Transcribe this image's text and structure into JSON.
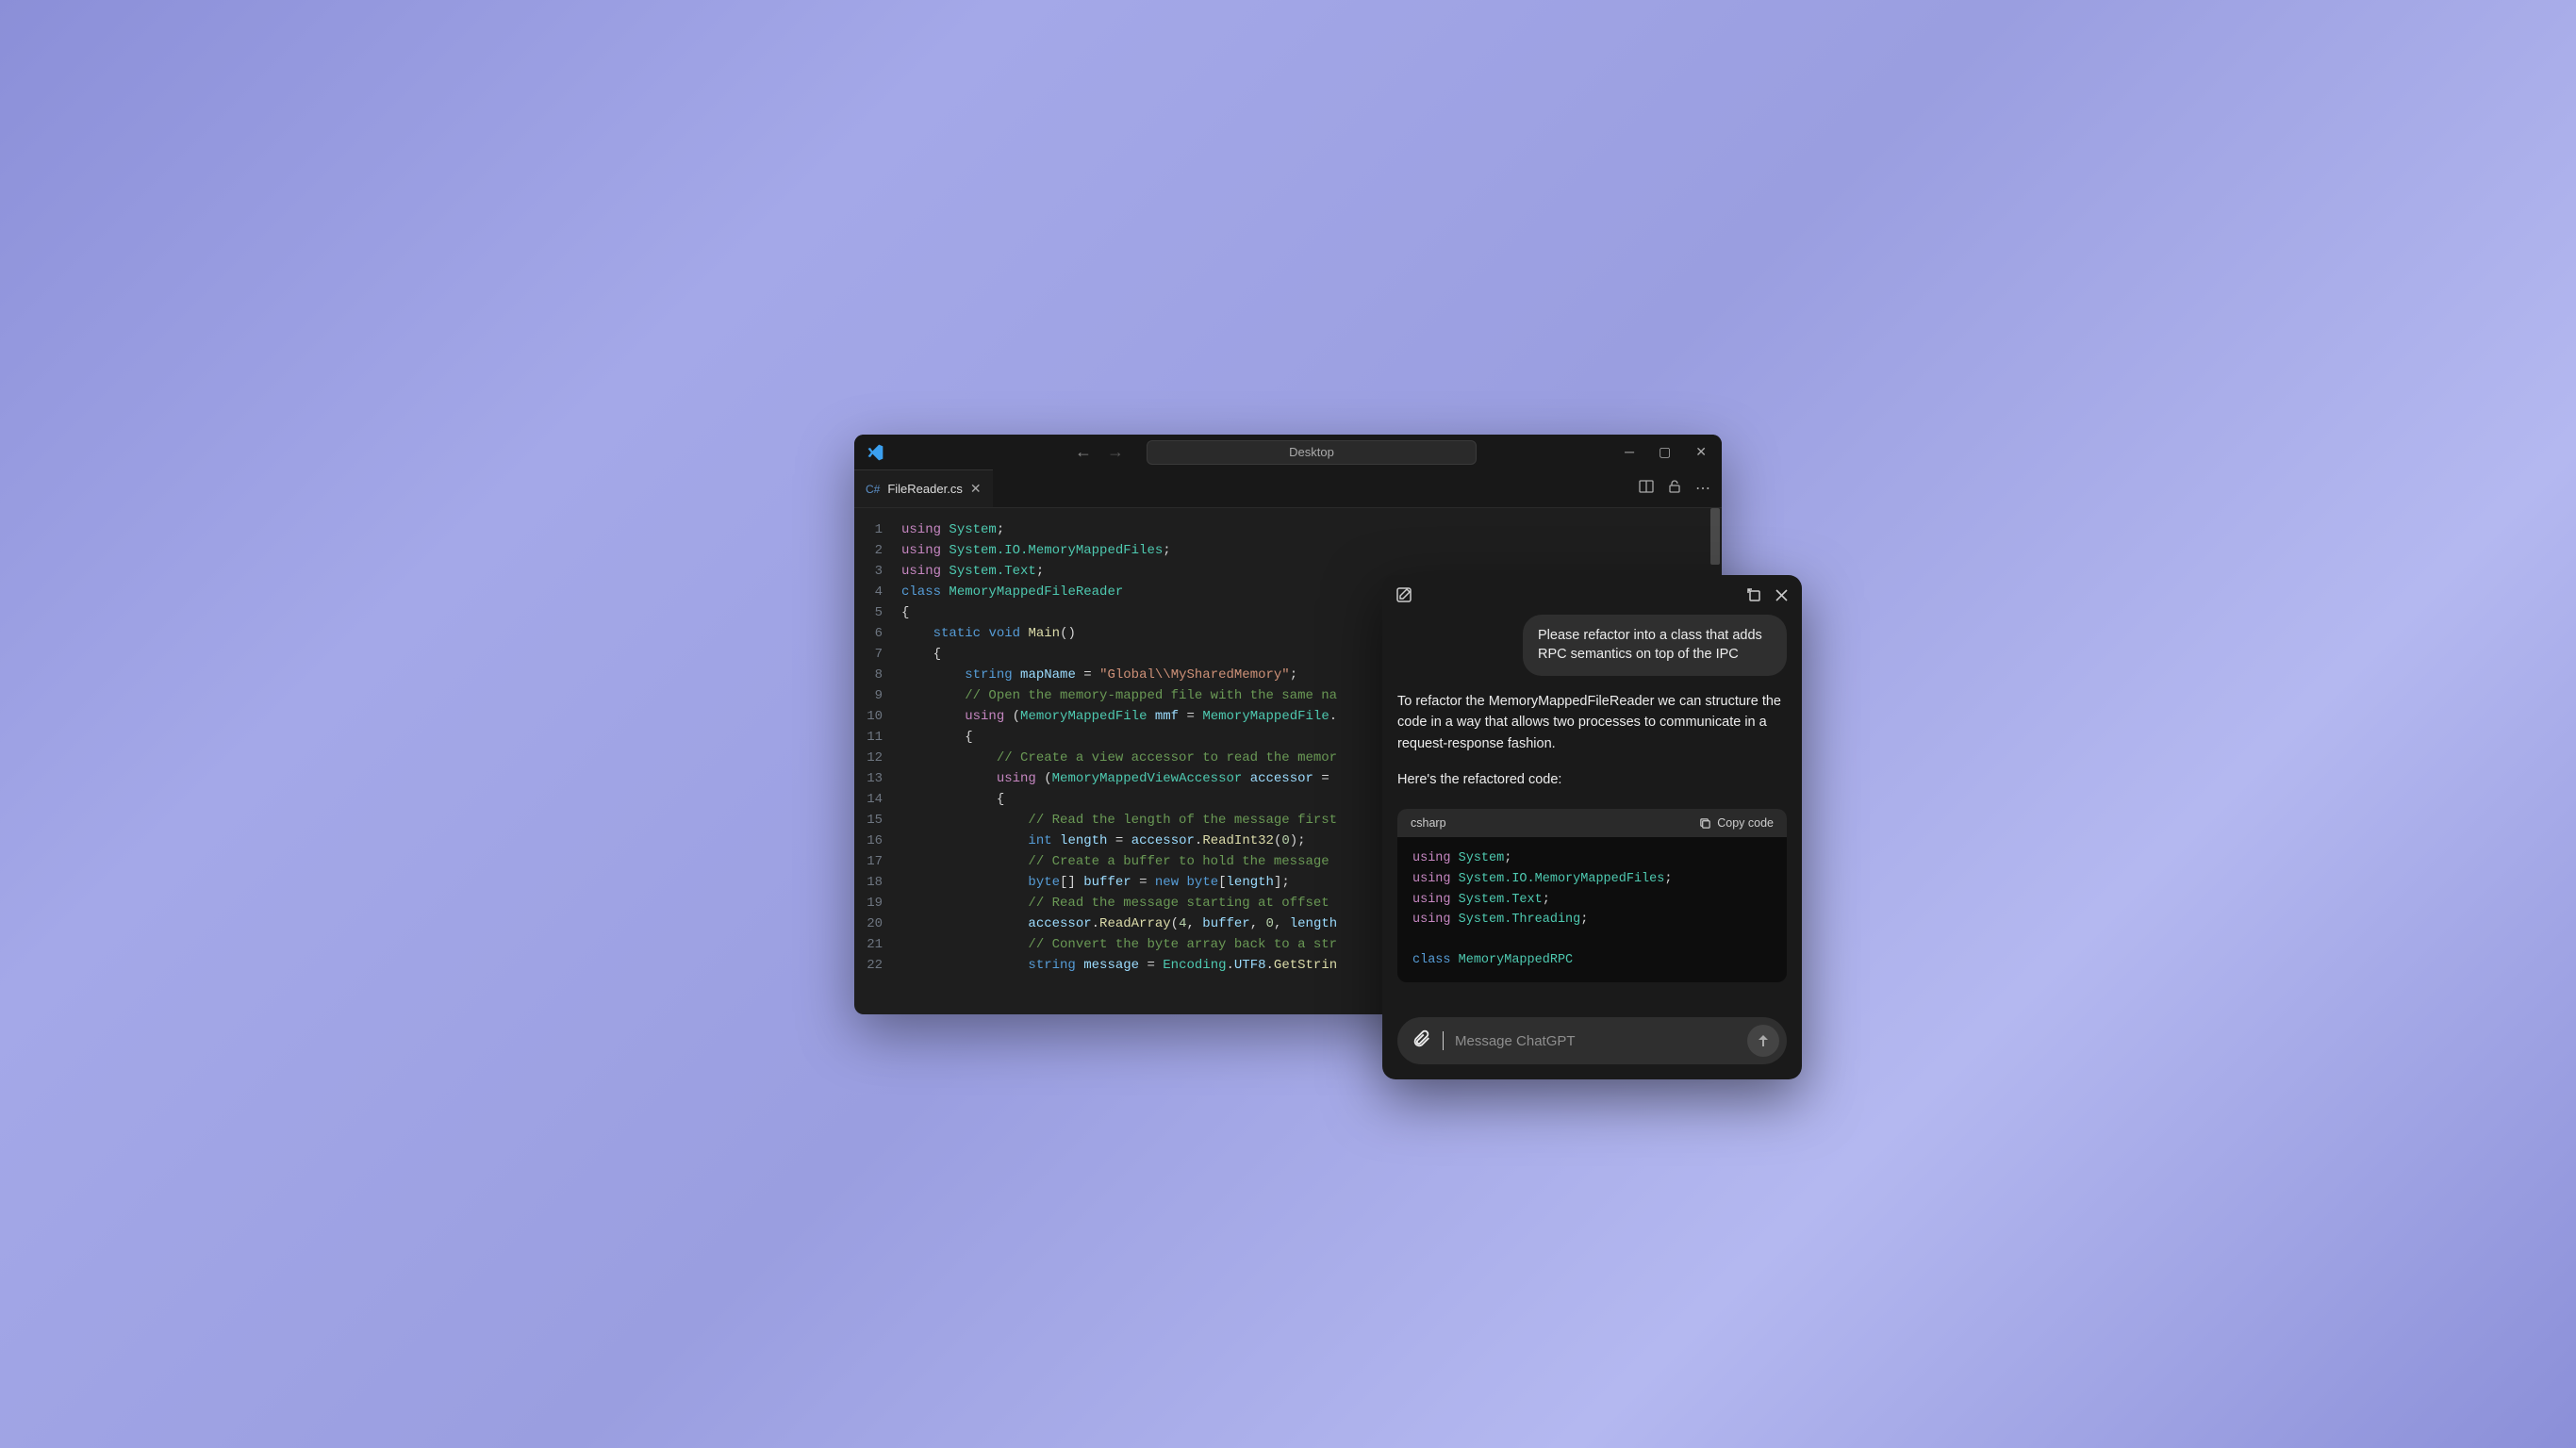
{
  "vscode": {
    "searchPlaceholder": "Desktop",
    "tab": {
      "filename": "FileReader.cs"
    },
    "lines": [
      {
        "n": "1",
        "tokens": [
          {
            "c": "kw",
            "t": "using"
          },
          {
            "c": "",
            "t": " "
          },
          {
            "c": "type",
            "t": "System"
          },
          {
            "c": "",
            "t": ";"
          }
        ]
      },
      {
        "n": "2",
        "tokens": [
          {
            "c": "kw",
            "t": "using"
          },
          {
            "c": "",
            "t": " "
          },
          {
            "c": "type",
            "t": "System.IO.MemoryMappedFiles"
          },
          {
            "c": "",
            "t": ";"
          }
        ]
      },
      {
        "n": "3",
        "tokens": [
          {
            "c": "kw",
            "t": "using"
          },
          {
            "c": "",
            "t": " "
          },
          {
            "c": "type",
            "t": "System.Text"
          },
          {
            "c": "",
            "t": ";"
          }
        ]
      },
      {
        "n": "4",
        "tokens": [
          {
            "c": "mod",
            "t": "class"
          },
          {
            "c": "",
            "t": " "
          },
          {
            "c": "type",
            "t": "MemoryMappedFileReader"
          }
        ]
      },
      {
        "n": "5",
        "tokens": [
          {
            "c": "",
            "t": "{"
          }
        ]
      },
      {
        "n": "6",
        "tokens": [
          {
            "c": "",
            "t": "    "
          },
          {
            "c": "mod",
            "t": "static"
          },
          {
            "c": "",
            "t": " "
          },
          {
            "c": "mod",
            "t": "void"
          },
          {
            "c": "",
            "t": " "
          },
          {
            "c": "fn",
            "t": "Main"
          },
          {
            "c": "",
            "t": "()"
          }
        ]
      },
      {
        "n": "7",
        "tokens": [
          {
            "c": "",
            "t": "    {"
          }
        ]
      },
      {
        "n": "8",
        "tokens": [
          {
            "c": "",
            "t": "        "
          },
          {
            "c": "mod",
            "t": "string"
          },
          {
            "c": "",
            "t": " "
          },
          {
            "c": "var",
            "t": "mapName"
          },
          {
            "c": "",
            "t": " = "
          },
          {
            "c": "str",
            "t": "\"Global\\\\MySharedMemory\""
          },
          {
            "c": "",
            "t": ";"
          }
        ]
      },
      {
        "n": "9",
        "tokens": [
          {
            "c": "",
            "t": "        "
          },
          {
            "c": "cmt",
            "t": "// Open the memory-mapped file with the same na"
          }
        ]
      },
      {
        "n": "10",
        "tokens": [
          {
            "c": "",
            "t": "        "
          },
          {
            "c": "kw",
            "t": "using"
          },
          {
            "c": "",
            "t": " ("
          },
          {
            "c": "type",
            "t": "MemoryMappedFile"
          },
          {
            "c": "",
            "t": " "
          },
          {
            "c": "var",
            "t": "mmf"
          },
          {
            "c": "",
            "t": " = "
          },
          {
            "c": "type",
            "t": "MemoryMappedFile"
          },
          {
            "c": "",
            "t": "."
          }
        ]
      },
      {
        "n": "11",
        "tokens": [
          {
            "c": "",
            "t": "        {"
          }
        ]
      },
      {
        "n": "12",
        "tokens": [
          {
            "c": "",
            "t": "            "
          },
          {
            "c": "cmt",
            "t": "// Create a view accessor to read the memor"
          }
        ]
      },
      {
        "n": "13",
        "tokens": [
          {
            "c": "",
            "t": "            "
          },
          {
            "c": "kw",
            "t": "using"
          },
          {
            "c": "",
            "t": " ("
          },
          {
            "c": "type",
            "t": "MemoryMappedViewAccessor"
          },
          {
            "c": "",
            "t": " "
          },
          {
            "c": "var",
            "t": "accessor"
          },
          {
            "c": "",
            "t": " = "
          }
        ]
      },
      {
        "n": "14",
        "tokens": [
          {
            "c": "",
            "t": "            {"
          }
        ]
      },
      {
        "n": "15",
        "tokens": [
          {
            "c": "",
            "t": "                "
          },
          {
            "c": "cmt",
            "t": "// Read the length of the message first"
          }
        ]
      },
      {
        "n": "16",
        "tokens": [
          {
            "c": "",
            "t": "                "
          },
          {
            "c": "mod",
            "t": "int"
          },
          {
            "c": "",
            "t": " "
          },
          {
            "c": "var",
            "t": "length"
          },
          {
            "c": "",
            "t": " = "
          },
          {
            "c": "var",
            "t": "accessor"
          },
          {
            "c": "",
            "t": "."
          },
          {
            "c": "fn",
            "t": "ReadInt32"
          },
          {
            "c": "",
            "t": "("
          },
          {
            "c": "num",
            "t": "0"
          },
          {
            "c": "",
            "t": ");"
          }
        ]
      },
      {
        "n": "17",
        "tokens": [
          {
            "c": "",
            "t": "                "
          },
          {
            "c": "cmt",
            "t": "// Create a buffer to hold the message "
          }
        ]
      },
      {
        "n": "18",
        "tokens": [
          {
            "c": "",
            "t": "                "
          },
          {
            "c": "mod",
            "t": "byte"
          },
          {
            "c": "",
            "t": "[] "
          },
          {
            "c": "var",
            "t": "buffer"
          },
          {
            "c": "",
            "t": " = "
          },
          {
            "c": "mod",
            "t": "new"
          },
          {
            "c": "",
            "t": " "
          },
          {
            "c": "mod",
            "t": "byte"
          },
          {
            "c": "",
            "t": "["
          },
          {
            "c": "var",
            "t": "length"
          },
          {
            "c": "",
            "t": "];"
          }
        ]
      },
      {
        "n": "19",
        "tokens": [
          {
            "c": "",
            "t": "                "
          },
          {
            "c": "cmt",
            "t": "// Read the message starting at offset "
          }
        ]
      },
      {
        "n": "20",
        "tokens": [
          {
            "c": "",
            "t": "                "
          },
          {
            "c": "var",
            "t": "accessor"
          },
          {
            "c": "",
            "t": "."
          },
          {
            "c": "fn",
            "t": "ReadArray"
          },
          {
            "c": "",
            "t": "("
          },
          {
            "c": "num",
            "t": "4"
          },
          {
            "c": "",
            "t": ", "
          },
          {
            "c": "var",
            "t": "buffer"
          },
          {
            "c": "",
            "t": ", "
          },
          {
            "c": "num",
            "t": "0"
          },
          {
            "c": "",
            "t": ", "
          },
          {
            "c": "var",
            "t": "length"
          }
        ]
      },
      {
        "n": "21",
        "tokens": [
          {
            "c": "",
            "t": "                "
          },
          {
            "c": "cmt",
            "t": "// Convert the byte array back to a str"
          }
        ]
      },
      {
        "n": "22",
        "tokens": [
          {
            "c": "",
            "t": "                "
          },
          {
            "c": "mod",
            "t": "string"
          },
          {
            "c": "",
            "t": " "
          },
          {
            "c": "var",
            "t": "message"
          },
          {
            "c": "",
            "t": " = "
          },
          {
            "c": "type",
            "t": "Encoding"
          },
          {
            "c": "",
            "t": "."
          },
          {
            "c": "var",
            "t": "UTF8"
          },
          {
            "c": "",
            "t": "."
          },
          {
            "c": "fn",
            "t": "GetStrin"
          }
        ]
      }
    ]
  },
  "chat": {
    "userMessage": "Please refactor into a class that adds RPC semantics on top of the IPC",
    "assistantP1": "To refactor the MemoryMappedFileReader we can structure the code in a way that allows two processes to communicate in a request-response fashion.",
    "assistantP2": "Here's the refactored code:",
    "codeLang": "csharp",
    "copyLabel": "Copy code",
    "codeLines": [
      [
        {
          "c": "kw",
          "t": "using"
        },
        {
          "c": "",
          "t": " "
        },
        {
          "c": "type",
          "t": "System"
        },
        {
          "c": "",
          "t": ";"
        }
      ],
      [
        {
          "c": "kw",
          "t": "using"
        },
        {
          "c": "",
          "t": " "
        },
        {
          "c": "type",
          "t": "System.IO.MemoryMappedFiles"
        },
        {
          "c": "",
          "t": ";"
        }
      ],
      [
        {
          "c": "kw",
          "t": "using"
        },
        {
          "c": "",
          "t": " "
        },
        {
          "c": "type",
          "t": "System.Text"
        },
        {
          "c": "",
          "t": ";"
        }
      ],
      [
        {
          "c": "kw",
          "t": "using"
        },
        {
          "c": "",
          "t": " "
        },
        {
          "c": "type",
          "t": "System.Threading"
        },
        {
          "c": "",
          "t": ";"
        }
      ],
      [
        {
          "c": "",
          "t": ""
        }
      ],
      [
        {
          "c": "mod",
          "t": "class"
        },
        {
          "c": "",
          "t": " "
        },
        {
          "c": "type",
          "t": "MemoryMappedRPC"
        }
      ]
    ],
    "inputPlaceholder": "Message ChatGPT"
  }
}
